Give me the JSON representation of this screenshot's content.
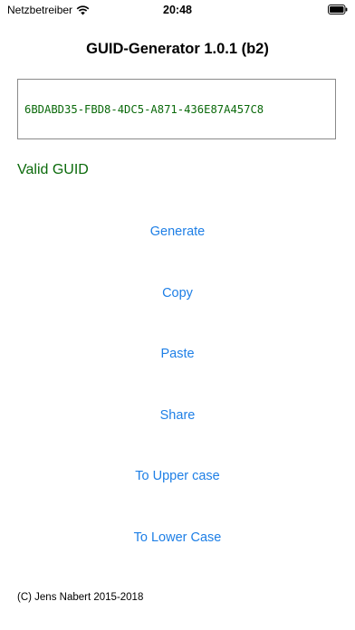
{
  "status_bar": {
    "carrier": "Netzbetreiber",
    "time": "20:48",
    "icons": [
      "wifi-icon",
      "battery-icon"
    ]
  },
  "app": {
    "title": "GUID-Generator 1.0.1 (b2)"
  },
  "guid": {
    "value": "6BDABD35-FBD8-4DC5-A871-436E87A457C8",
    "status": "Valid GUID"
  },
  "actions": {
    "generate": "Generate",
    "copy": "Copy",
    "paste": "Paste",
    "share": "Share",
    "upper": "To Upper case",
    "lower": "To Lower Case"
  },
  "footer": {
    "copyright": "(C) Jens Nabert 2015-2018"
  },
  "colors": {
    "accent": "#1e7fe6",
    "valid": "#0b6a0b"
  }
}
